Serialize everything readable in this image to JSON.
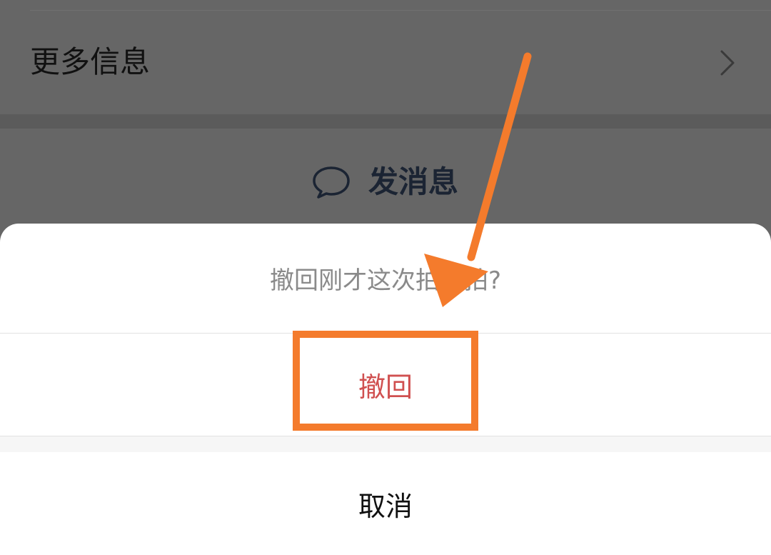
{
  "background": {
    "more_info": {
      "label": "更多信息",
      "icon": "chevron-right-icon"
    },
    "send_message": {
      "icon": "chat-bubble-icon",
      "label": "发消息"
    }
  },
  "action_sheet": {
    "title": "撤回刚才这次拍一拍?",
    "recall_label": "撤回",
    "cancel_label": "取消"
  },
  "annotation": {
    "arrow_icon": "arrow-icon",
    "highlight_color": "#f47b2c"
  },
  "colors": {
    "overlay_gray": "#666666",
    "destructive_red": "#d05050",
    "accent_orange": "#f47b2c",
    "sheet_white": "#ffffff"
  }
}
